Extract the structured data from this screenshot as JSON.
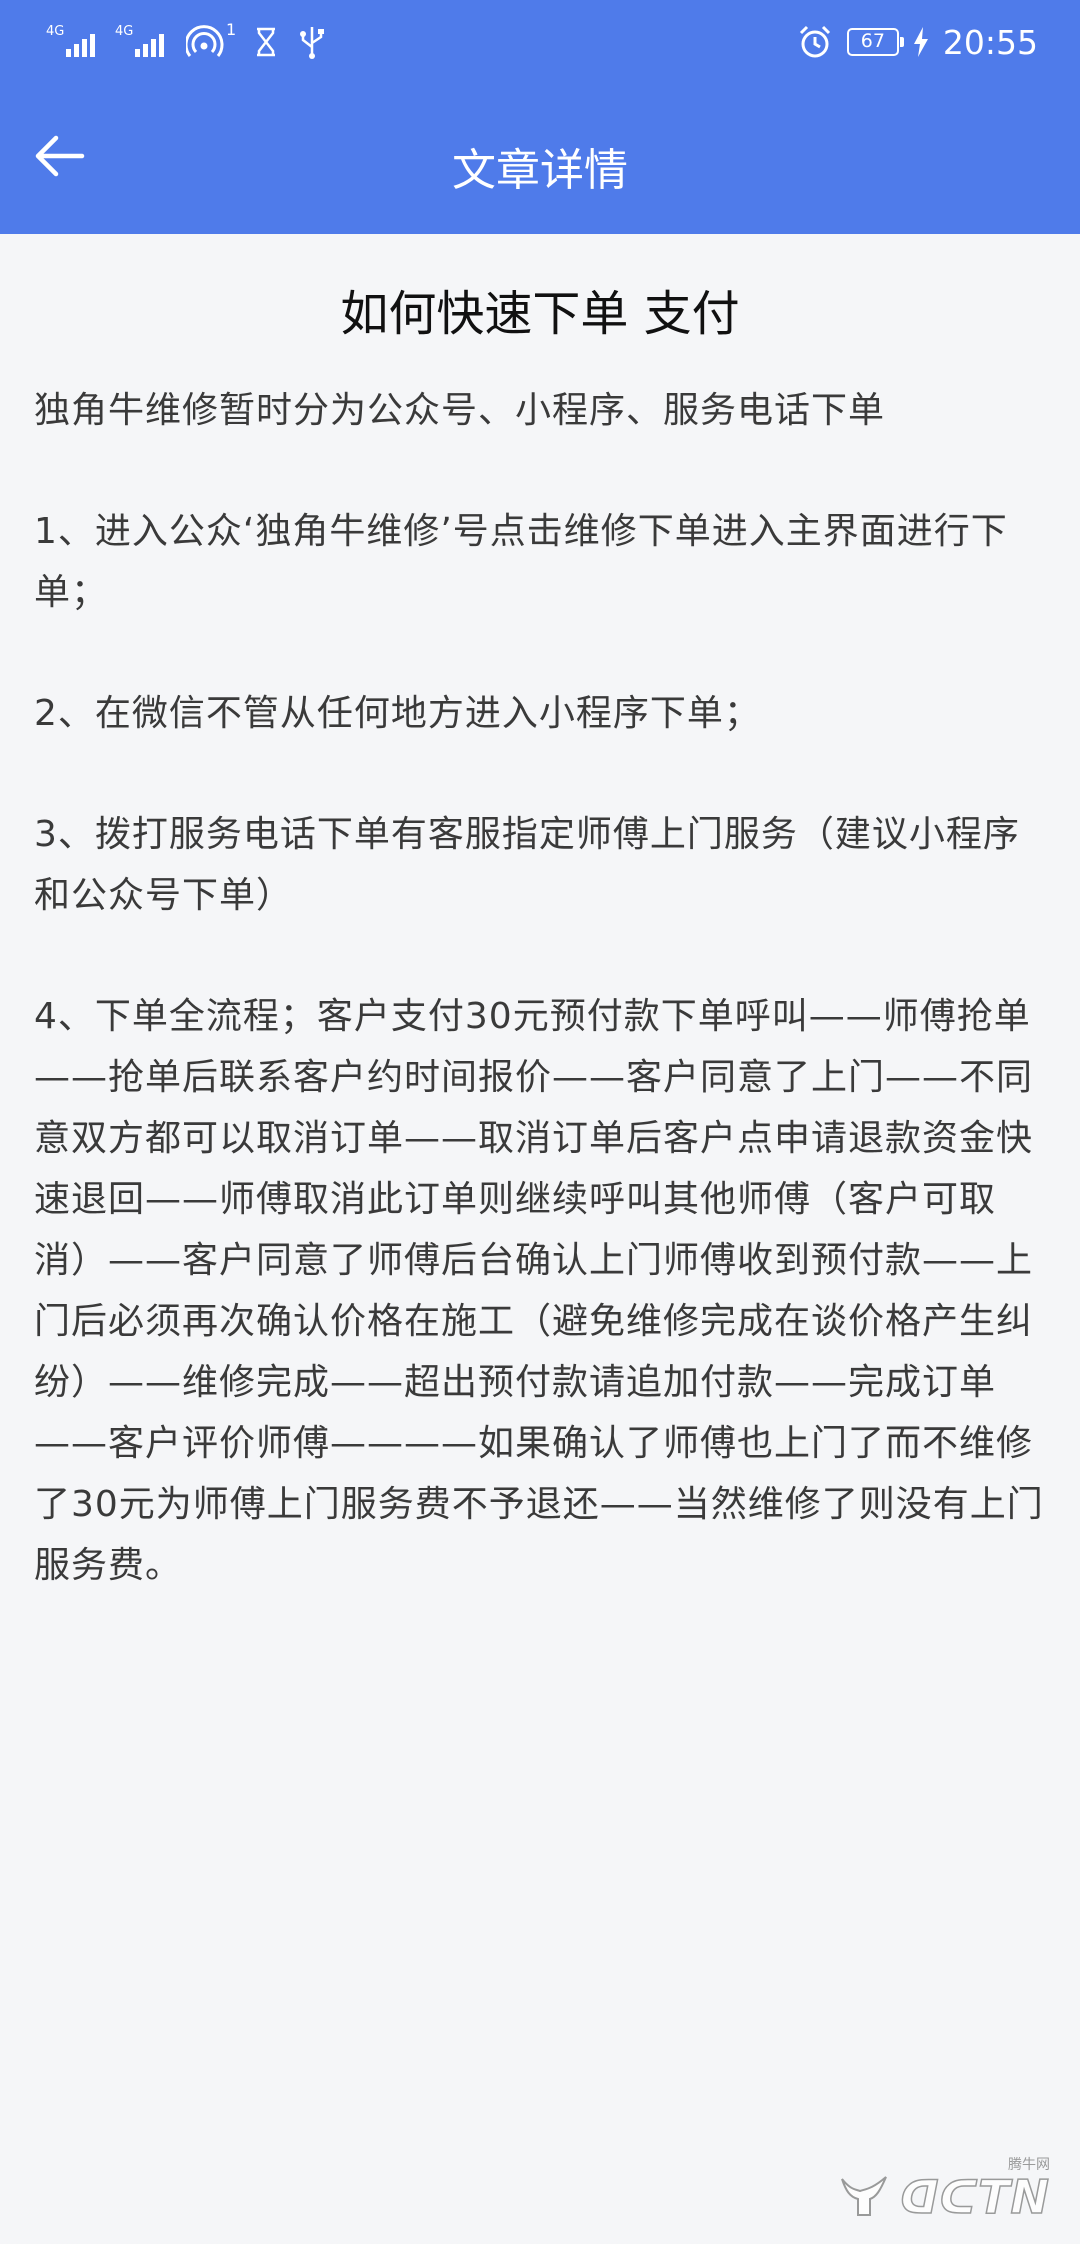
{
  "status_bar": {
    "network_1": "4G",
    "network_2": "4G",
    "hotspot_badge": "1",
    "battery_level": "67",
    "time": "20:55"
  },
  "app_bar": {
    "title": "文章详情",
    "back_icon": "back-arrow-icon"
  },
  "article": {
    "title": "如何快速下单 支付",
    "intro": "独角牛维修暂时分为公众号、小程序、服务电话下单",
    "paragraphs": [
      "1、进入公众‘独角牛维修’号点击维修下单进入主界面进行下单；",
      "2、在微信不管从任何地方进入小程序下单；",
      "3、拨打服务电话下单有客服指定师傅上门服务（建议小程序和公众号下单）",
      "4、下单全流程；客户支付30元预付款下单呼叫——师傅抢单——抢单后联系客户约时间报价——客户同意了上门——不同意双方都可以取消订单——取消订单后客户点申请退款资金快速退回——师傅取消此订单则继续呼叫其他师傅（客户可取消）——客户同意了师傅后台确认上门师傅收到预付款——上门后必须再次确认价格在施工（避免维修完成在谈价格产生纠纷）——维修完成——超出预付款请追加付款——完成订单——客户评价师傅————如果确认了师傅也上门了而不维修了30元为师傅上门服务费不予退还——当然维修了则没有上门服务费。"
    ]
  },
  "watermark": {
    "text": "ᗡᑕTN",
    "small": "腾牛网"
  },
  "colors": {
    "header_bg": "#4f7bea",
    "page_bg": "#f5f6f8",
    "body_text": "#3a3a3a",
    "title_text": "#111111"
  }
}
